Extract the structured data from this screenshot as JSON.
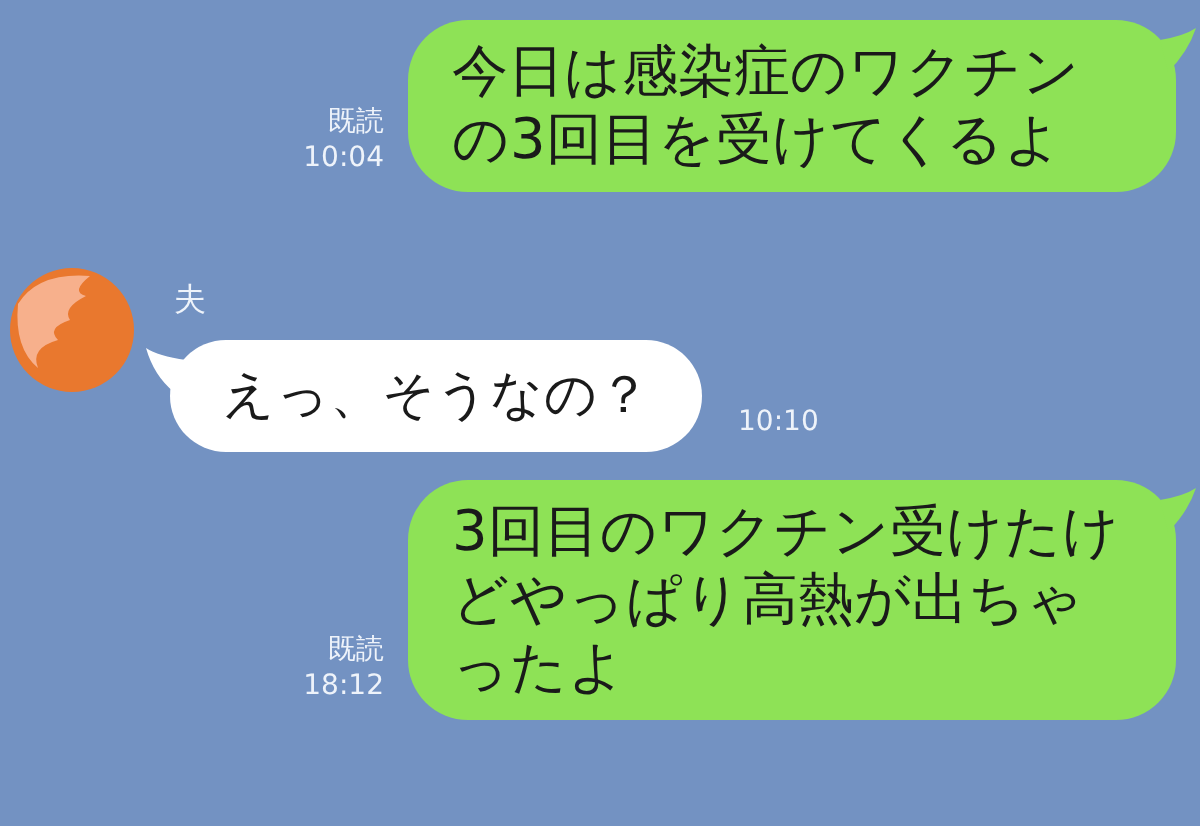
{
  "messages": [
    {
      "kind": "sent",
      "text": "今日は感染症のワクチンの3回目を受けてくるよ",
      "read_label": "既読",
      "time": "10:04"
    },
    {
      "kind": "received",
      "sender": "夫",
      "text": "えっ、そうなの？",
      "time": "10:10"
    },
    {
      "kind": "sent",
      "text": "3回目のワクチン受けたけどやっぱり高熱が出ちゃったよ",
      "read_label": "既読",
      "time": "18:12"
    }
  ]
}
